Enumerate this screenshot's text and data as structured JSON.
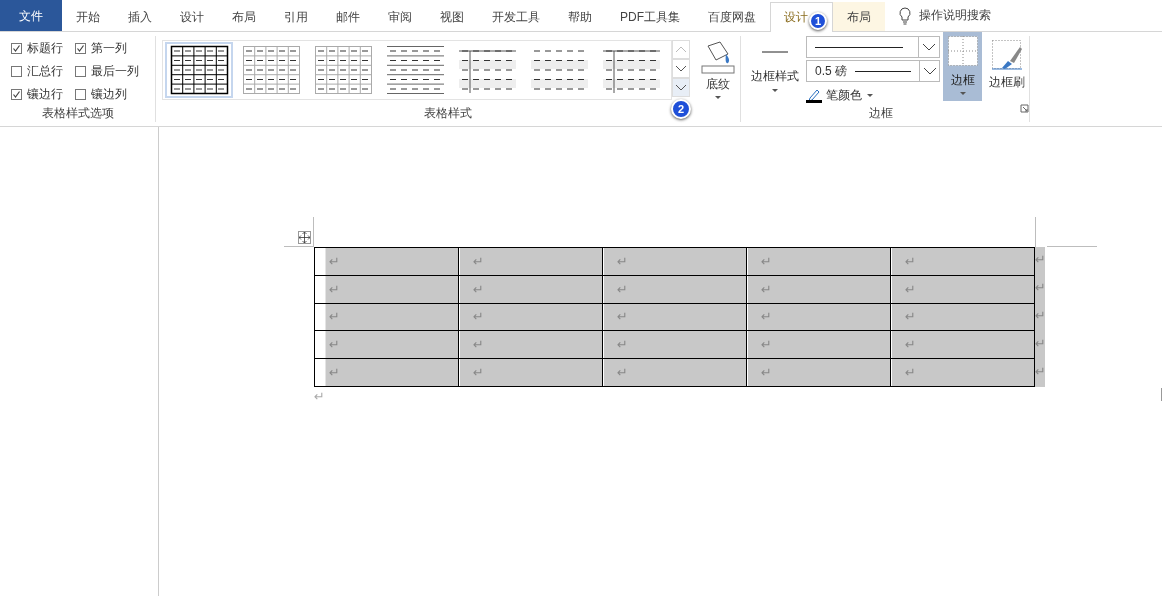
{
  "tabs": [
    {
      "label": "文件",
      "kind": "file",
      "selected": false
    },
    {
      "label": "开始",
      "kind": "normal",
      "selected": false
    },
    {
      "label": "插入",
      "kind": "normal",
      "selected": false
    },
    {
      "label": "设计",
      "kind": "normal",
      "selected": false
    },
    {
      "label": "布局",
      "kind": "normal",
      "selected": false
    },
    {
      "label": "引用",
      "kind": "normal",
      "selected": false
    },
    {
      "label": "邮件",
      "kind": "normal",
      "selected": false
    },
    {
      "label": "审阅",
      "kind": "normal",
      "selected": false
    },
    {
      "label": "视图",
      "kind": "normal",
      "selected": false
    },
    {
      "label": "开发工具",
      "kind": "normal",
      "selected": false
    },
    {
      "label": "帮助",
      "kind": "normal",
      "selected": false
    },
    {
      "label": "PDF工具集",
      "kind": "normal",
      "selected": false
    },
    {
      "label": "百度网盘",
      "kind": "normal",
      "selected": false
    },
    {
      "label": "设计",
      "kind": "contextual",
      "selected": true,
      "badge": "1"
    },
    {
      "label": "布局",
      "kind": "contextual",
      "selected": false
    }
  ],
  "tell_me": {
    "label": "操作说明搜索"
  },
  "style_options": {
    "title": "表格样式选项",
    "options": [
      {
        "label": "标题行",
        "checked": true
      },
      {
        "label": "第一列",
        "checked": true
      },
      {
        "label": "汇总行",
        "checked": false
      },
      {
        "label": "最后一列",
        "checked": false
      },
      {
        "label": "镶边行",
        "checked": true
      },
      {
        "label": "镶边列",
        "checked": false
      }
    ]
  },
  "table_styles": {
    "title": "表格样式",
    "styles": [
      {
        "kind": "grid-bold",
        "selected": true
      },
      {
        "kind": "grid",
        "selected": false
      },
      {
        "kind": "grid",
        "selected": false
      },
      {
        "kind": "lines",
        "selected": false
      },
      {
        "kind": "first-col",
        "selected": false
      },
      {
        "kind": "banded",
        "selected": false
      },
      {
        "kind": "first-col",
        "selected": false
      }
    ],
    "more_badge": "2",
    "shading": {
      "label": "底纹"
    }
  },
  "borders": {
    "title": "边框",
    "border_styles": {
      "label": "边框样式"
    },
    "pen_weight": "0.5 磅",
    "pen_color": {
      "label": "笔颜色"
    },
    "borders_button": {
      "label": "边框",
      "selected": true
    },
    "border_painter": {
      "label": "边框刷"
    }
  },
  "document": {
    "table": {
      "rows": [
        [
          "↵",
          "↵",
          "↵",
          "↵",
          "↵"
        ],
        [
          "↵",
          "↵",
          "↵",
          "↵",
          "↵"
        ],
        [
          "↵",
          "↵",
          "↵",
          "↵",
          "↵"
        ],
        [
          "↵",
          "↵",
          "↵",
          "↵",
          "↵"
        ],
        [
          "↵",
          "↵",
          "↵",
          "↵",
          "↵"
        ]
      ],
      "row_marks": [
        "↵",
        "↵",
        "↵",
        "↵",
        "↵"
      ]
    },
    "paragraph_mark": "↵"
  }
}
